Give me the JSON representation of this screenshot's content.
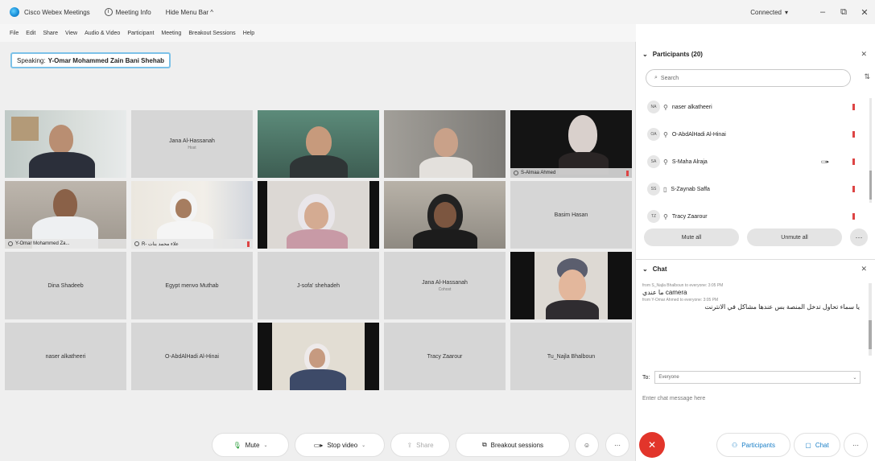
{
  "titlebar": {
    "app_name": "Cisco Webex Meetings",
    "meeting_info": "Meeting Info",
    "hide_menu": "Hide Menu Bar ^",
    "connected": "Connected",
    "connected_chevron": "▾",
    "minimize": "–",
    "restore": "⧉",
    "close": "✕"
  },
  "menu": [
    "File",
    "Edit",
    "Share",
    "View",
    "Audio & Video",
    "Participant",
    "Meeting",
    "Breakout Sessions",
    "Help"
  ],
  "speaking": {
    "label": "Speaking:",
    "name": "Y-Omar Mohammed Zain Bani Shehab"
  },
  "tiles": [
    {
      "name": "",
      "sub": "",
      "video": true
    },
    {
      "name": "Jana Al-Hassanah",
      "sub": "Host",
      "video": false
    },
    {
      "name": "",
      "sub": "",
      "video": true
    },
    {
      "name": "",
      "sub": "",
      "video": true
    },
    {
      "name": "S-Almaa Ahmed",
      "sub": "",
      "video": true
    },
    {
      "name": "Y-Omar Mohammed Za...",
      "sub": "",
      "video": true
    },
    {
      "name": "R- علاء محمد بنات",
      "sub": "",
      "video": true
    },
    {
      "name": "",
      "sub": "",
      "video": true
    },
    {
      "name": "",
      "sub": "",
      "video": true
    },
    {
      "name": "Basim Hasan",
      "sub": "",
      "video": false
    },
    {
      "name": "Dina Shadeeb",
      "sub": "",
      "video": false
    },
    {
      "name": "Egypt menvo Muthab",
      "sub": "",
      "video": false
    },
    {
      "name": "J-sofa' shehadeh",
      "sub": "",
      "video": false
    },
    {
      "name": "Jana Al-Hassanah",
      "sub": "Cohost",
      "video": false
    },
    {
      "name": "",
      "sub": "",
      "video": true
    },
    {
      "name": "naser alkatheeri",
      "sub": "",
      "video": false
    },
    {
      "name": "O-AbdAlHadi Al-Hinai",
      "sub": "",
      "video": false
    },
    {
      "name": "",
      "sub": "",
      "video": true
    },
    {
      "name": "Tracy Zaarour",
      "sub": "",
      "video": false
    },
    {
      "name": "Tu_Najla Bhalboun",
      "sub": "",
      "video": false
    }
  ],
  "participants": {
    "title": "Participants (20)",
    "search_placeholder": "Search",
    "list": [
      {
        "initials": "NA",
        "name": "naser alkatheeri",
        "video": ""
      },
      {
        "initials": "OA",
        "name": "O-AbdAlHadi Al-Hinai",
        "video": ""
      },
      {
        "initials": "SA",
        "name": "S-Maha Alraja",
        "video": "▭▸"
      },
      {
        "initials": "SS",
        "name": "S-Zaynab Saffa",
        "video": ""
      },
      {
        "initials": "TZ",
        "name": "Tracy Zaarour",
        "video": ""
      }
    ],
    "mute_all": "Mute all",
    "unmute_all": "Unmute all",
    "more": "···"
  },
  "chat": {
    "title": "Chat",
    "messages": [
      {
        "meta": "from S_Najla Bhalboun to everyone: 3:05 PM",
        "text": "ما عندي camera",
        "rtl": false
      },
      {
        "meta": "from Y-Omar Ahmed to everyone: 3:05 PM",
        "text": "يا سماء تحاول تدخل المنصة بس عندها مشاكل في الانترنت",
        "rtl": true
      }
    ],
    "to_label": "To:",
    "to_value": "Everyone",
    "input_placeholder": "Enter chat message here"
  },
  "controls": {
    "mute": "Mute",
    "stop_video": "Stop video",
    "share": "Share",
    "breakout": "Breakout sessions",
    "more": "···",
    "participants": "Participants",
    "chat": "Chat",
    "end_icon": "✕"
  }
}
